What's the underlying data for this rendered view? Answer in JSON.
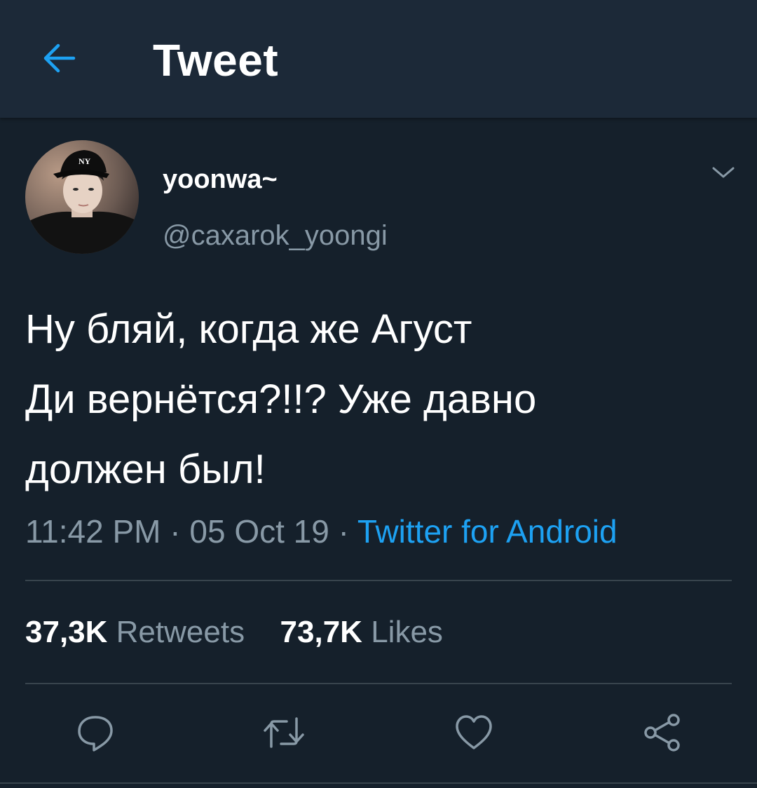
{
  "header": {
    "title": "Tweet",
    "back_icon": "arrow-left-icon"
  },
  "tweet": {
    "display_name": "yoonwa~",
    "handle": "@caxarok_yoongi",
    "text": "Ну бляй, когда же Агуст\nДи вернётся?!!? Уже давно\nдолжен был!",
    "time": "11:42 PM",
    "date": "05 Oct 19",
    "separator": "·",
    "source": "Twitter for Android",
    "retweets_count": "37,3K",
    "retweets_label": "Retweets",
    "likes_count": "73,7K",
    "likes_label": "Likes"
  },
  "actions": [
    "reply-icon",
    "retweet-icon",
    "like-icon",
    "share-icon"
  ],
  "colors": {
    "background": "#15202b",
    "header": "#1c2938",
    "accent": "#1da1f2",
    "secondary_text": "#8899a6",
    "divider": "#38444d"
  }
}
